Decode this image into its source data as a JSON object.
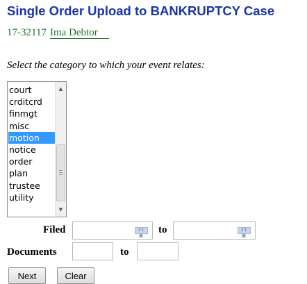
{
  "header": {
    "title": "Single Order Upload to BANKRUPTCY Case",
    "case_number": "17-32117",
    "debtor": "Ima Debtor"
  },
  "category_select": {
    "instruction": "Select the category to which your event relates:",
    "options": [
      "court",
      "crditcrd",
      "finmgt",
      "misc",
      "motion",
      "notice",
      "order",
      "plan",
      "trustee",
      "utility"
    ],
    "selected": "motion"
  },
  "filters": {
    "filed_label": "Filed",
    "filed_to_label": "to",
    "filed_from_value": "",
    "filed_to_value": "",
    "documents_label": "Documents",
    "documents_to_label": "to",
    "documents_from_value": "",
    "documents_to_value": ""
  },
  "buttons": {
    "next": "Next",
    "clear": "Clear"
  },
  "icons": {
    "filed_from_calendar": "calendar-icon",
    "filed_to_calendar": "calendar-icon"
  },
  "colors": {
    "title": "#1a35a8",
    "case_link": "#18742a",
    "selection": "#3399ff"
  }
}
